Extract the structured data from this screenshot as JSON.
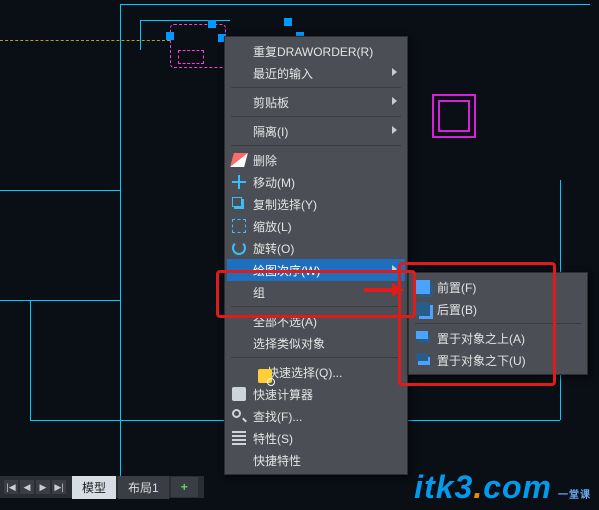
{
  "tabs": {
    "nav": {
      "first": "|◀",
      "prev": "◀",
      "next": "▶",
      "last": "▶|"
    },
    "items": [
      "模型",
      "布局1"
    ],
    "active_index": 0,
    "add": "+"
  },
  "context_menu": {
    "repeat": "重复DRAWORDER(R)",
    "recent_input": "最近的输入",
    "clipboard": "剪贴板",
    "isolate": "隔离(I)",
    "erase": "删除",
    "move": "移动(M)",
    "copy_sel": "复制选择(Y)",
    "scale": "缩放(L)",
    "rotate": "旋转(O)",
    "draworder": "绘图次序(W)",
    "group": "组",
    "deselect": "全部不选(A)",
    "select_similar": "选择类似对象",
    "qselect": "快速选择(Q)...",
    "quickcalc": "快速计算器",
    "find": "查找(F)...",
    "properties": "特性(S)",
    "quickprops": "快捷特性"
  },
  "draworder_sub": {
    "front": "前置(F)",
    "back": "后置(B)",
    "above": "置于对象之上(A)",
    "under": "置于对象之下(U)"
  },
  "watermark": {
    "t1": "itk3",
    "dot": ".",
    "t2": "com",
    "cn": "一堂课"
  }
}
